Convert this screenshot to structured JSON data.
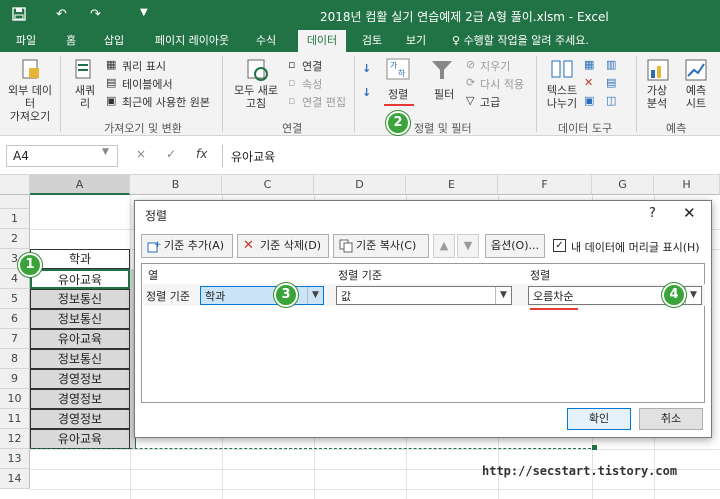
{
  "window": {
    "title": "2018년 컴활 실기 연습예제 2급 A형 풀이.xlsm - Excel",
    "qa_icons": [
      "save-icon",
      "undo-icon",
      "redo-icon",
      "customize-icon"
    ]
  },
  "tabs": [
    "파일",
    "홈",
    "삽입",
    "페이지 레이아웃",
    "수식",
    "데이터",
    "검토",
    "보기"
  ],
  "active_tab": "데이터",
  "tell_me": "수행할 작업을 알려 주세요.",
  "ribbon": {
    "get_external": "외부 데이터\n가져오기",
    "new_query": "새쿼\n리",
    "show_queries": "쿼리 표시",
    "from_table": "테이블에서",
    "recent_sources": "최근에 사용한 원본",
    "group_get_transform": "가져오기 및 변환",
    "refresh_all": "모두 새로\n고침",
    "connections": "연결",
    "properties": "속성",
    "edit_links": "연결 편집",
    "group_connections": "연결",
    "sort_button": "정렬",
    "filter_button": "필터",
    "clear": "지우기",
    "reapply": "다시 적용",
    "advanced": "고급",
    "group_sort_filter": "정렬 및 필터",
    "text_to_columns": "텍스트\n나누기",
    "group_data_tools": "데이터 도구",
    "what_if": "가상\n분석",
    "forecast_sheet": "예측\n시트",
    "group_forecast": "예측"
  },
  "formula_bar": {
    "name_box": "A4",
    "cancel": "×",
    "enter": "✓",
    "fx": "fx",
    "value": "유아교육"
  },
  "grid": {
    "columns": [
      "A",
      "B",
      "C",
      "D",
      "E",
      "F",
      "G",
      "H"
    ],
    "rows": [
      "1",
      "2",
      "3",
      "4",
      "5",
      "6",
      "7",
      "8",
      "9",
      "10",
      "11",
      "12",
      "13",
      "14"
    ],
    "header_cell": "학과",
    "values": [
      "유아교육",
      "정보통신",
      "정보통신",
      "유아교육",
      "정보통신",
      "경영정보",
      "경영정보",
      "경영정보",
      "유아교육"
    ]
  },
  "dialog": {
    "title": "정렬",
    "help": "?",
    "close": "✕",
    "add_level": "기준 추가(A)",
    "delete_level": "기준 삭제(D)",
    "copy_level": "기준 복사(C)",
    "move_up": "▲",
    "move_down": "▼",
    "options": "옵션(O)...",
    "headers_checkbox": "내 데이터에 머리글 표시(H)",
    "headers_checked": true,
    "col_header": "열",
    "sort_on_header": "정렬 기준",
    "order_header": "정렬",
    "row_label": "정렬 기준",
    "column_value": "학과",
    "sort_on_value": "값",
    "order_value": "오름차순",
    "ok": "확인",
    "cancel": "취소"
  },
  "steps": [
    "1",
    "2",
    "3",
    "4"
  ],
  "watermark": "http://secstart.tistory.com",
  "colors": {
    "accent": "#217346",
    "badge": "#3aa43a",
    "highlight": "#e53935",
    "selected_cell": "#d9d9d9"
  }
}
